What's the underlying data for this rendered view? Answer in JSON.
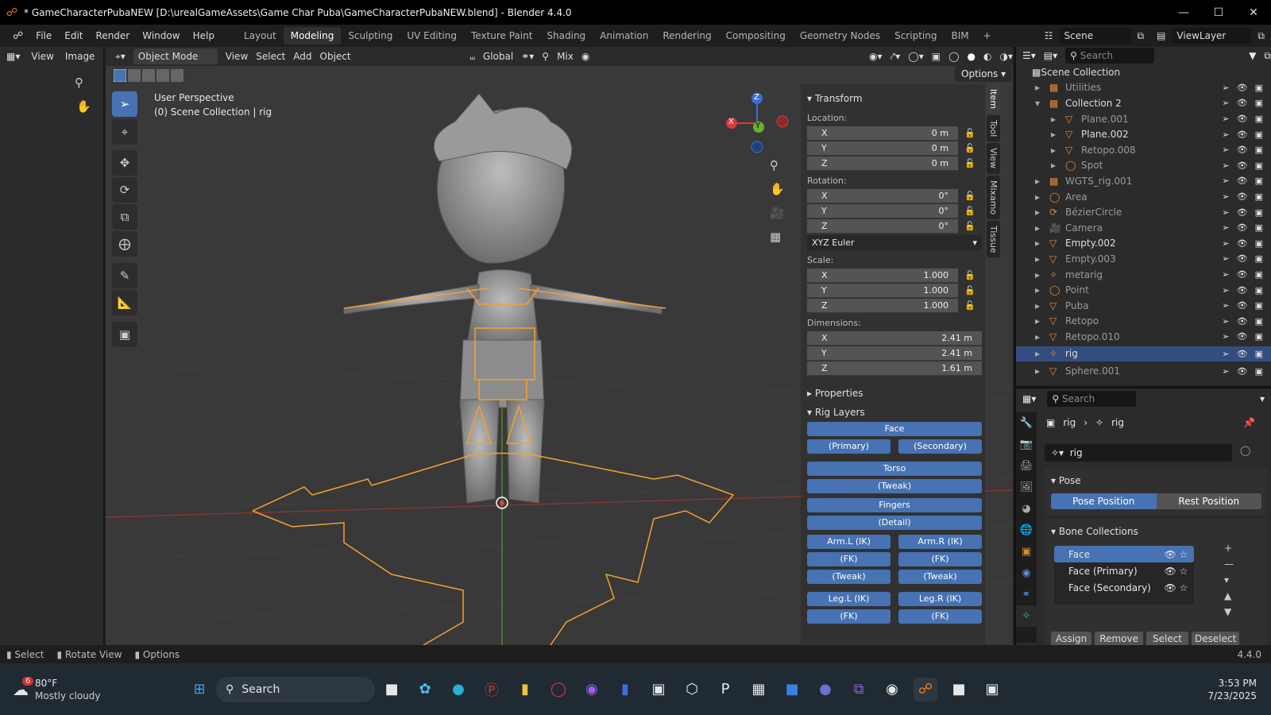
{
  "titlebar": {
    "title": "* GameCharacterPubaNEW [D:\\urealGameAssets\\Game Char Puba\\GameCharacterPubaNEW.blend] - Blender 4.4.0"
  },
  "menu": {
    "items": [
      "File",
      "Edit",
      "Render",
      "Window",
      "Help"
    ],
    "workspaces": [
      "Layout",
      "Modeling",
      "Sculpting",
      "UV Editing",
      "Texture Paint",
      "Shading",
      "Animation",
      "Rendering",
      "Compositing",
      "Geometry Nodes",
      "Scripting",
      "BIM"
    ],
    "active_workspace": "Modeling",
    "scene": "Scene",
    "view_layer": "ViewLayer"
  },
  "left_panel": {
    "view": "View",
    "image": "Image"
  },
  "viewport_header": {
    "mode": "Object Mode",
    "menus": [
      "View",
      "Select",
      "Add",
      "Object"
    ],
    "orientation": "Global",
    "snap_mode": "Mix",
    "options": "Options"
  },
  "viewport_info": {
    "line1": "User Perspective",
    "line2": "(0) Scene Collection | rig"
  },
  "gizmo": {
    "x": "X",
    "y": "Y",
    "z": "Z"
  },
  "sidebar_tabs": [
    "Item",
    "Tool",
    "View",
    "Mixamo",
    "Tissue"
  ],
  "transform": {
    "title": "Transform",
    "location_label": "Location:",
    "location": [
      {
        "axis": "X",
        "value": "0 m"
      },
      {
        "axis": "Y",
        "value": "0 m"
      },
      {
        "axis": "Z",
        "value": "0 m"
      }
    ],
    "rotation_label": "Rotation:",
    "rotation": [
      {
        "axis": "X",
        "value": "0°"
      },
      {
        "axis": "Y",
        "value": "0°"
      },
      {
        "axis": "Z",
        "value": "0°"
      }
    ],
    "rotation_mode": "XYZ Euler",
    "scale_label": "Scale:",
    "scale": [
      {
        "axis": "X",
        "value": "1.000"
      },
      {
        "axis": "Y",
        "value": "1.000"
      },
      {
        "axis": "Z",
        "value": "1.000"
      }
    ],
    "dimensions_label": "Dimensions:",
    "dimensions": [
      {
        "axis": "X",
        "value": "2.41 m"
      },
      {
        "axis": "Y",
        "value": "2.41 m"
      },
      {
        "axis": "Z",
        "value": "1.61 m"
      }
    ]
  },
  "properties_section": "Properties",
  "rig_layers": {
    "title": "Rig Layers",
    "face": "Face",
    "primary": "(Primary)",
    "secondary": "(Secondary)",
    "torso": "Torso",
    "tweak": "(Tweak)",
    "fingers": "Fingers",
    "detail": "(Detail)",
    "arm_l_ik": "Arm.L (IK)",
    "arm_r_ik": "Arm.R (IK)",
    "fk": "(FK)",
    "leg_l_ik": "Leg.L (IK)",
    "leg_r_ik": "Leg.R (IK)"
  },
  "outliner": {
    "search_placeholder": "Search",
    "root": "Scene Collection",
    "items": [
      {
        "name": "Utilities",
        "indent": 1,
        "dim": true
      },
      {
        "name": "Collection 2",
        "indent": 1,
        "expanded": true
      },
      {
        "name": "Plane.001",
        "indent": 2,
        "dim": true
      },
      {
        "name": "Plane.002",
        "indent": 2
      },
      {
        "name": "Retopo.008",
        "indent": 2,
        "dim": true
      },
      {
        "name": "Spot",
        "indent": 2,
        "dim": true
      },
      {
        "name": "WGTS_rig.001",
        "indent": 1,
        "dim": true
      },
      {
        "name": "Area",
        "indent": 1,
        "dim": true
      },
      {
        "name": "BézierCircle",
        "indent": 1,
        "dim": true
      },
      {
        "name": "Camera",
        "indent": 1,
        "dim": true
      },
      {
        "name": "Empty.002",
        "indent": 1
      },
      {
        "name": "Empty.003",
        "indent": 1,
        "dim": true
      },
      {
        "name": "metarig",
        "indent": 1,
        "dim": true
      },
      {
        "name": "Point",
        "indent": 1,
        "dim": true
      },
      {
        "name": "Puba",
        "indent": 1,
        "dim": true
      },
      {
        "name": "Retopo",
        "indent": 1,
        "dim": true
      },
      {
        "name": "Retopo.010",
        "indent": 1,
        "dim": true
      },
      {
        "name": "rig",
        "indent": 1,
        "selected": true
      },
      {
        "name": "Sphere.001",
        "indent": 1,
        "dim": true
      }
    ]
  },
  "properties": {
    "search_placeholder": "Search",
    "breadcrumb_a": "rig",
    "breadcrumb_b": "rig",
    "data_name": "rig",
    "pose_title": "Pose",
    "pose_position": "Pose Position",
    "rest_position": "Rest Position",
    "bone_collections_title": "Bone Collections",
    "collections": [
      "Face",
      "Face (Primary)",
      "Face (Secondary)"
    ],
    "assign": "Assign",
    "remove": "Remove",
    "select": "Select",
    "deselect": "Deselect"
  },
  "statusbar": {
    "select": "Select",
    "rotate": "Rotate View",
    "options": "Options",
    "version": "4.4.0"
  },
  "taskbar": {
    "weather_temp": "80°F",
    "weather_desc": "Mostly cloudy",
    "weather_badge": "6",
    "search": "Search",
    "time": "3:53 PM",
    "date": "7/23/2025"
  },
  "colors": {
    "accent": "#4772b3",
    "selection_orange": "#f5a030",
    "header": "#2b2b2b"
  }
}
